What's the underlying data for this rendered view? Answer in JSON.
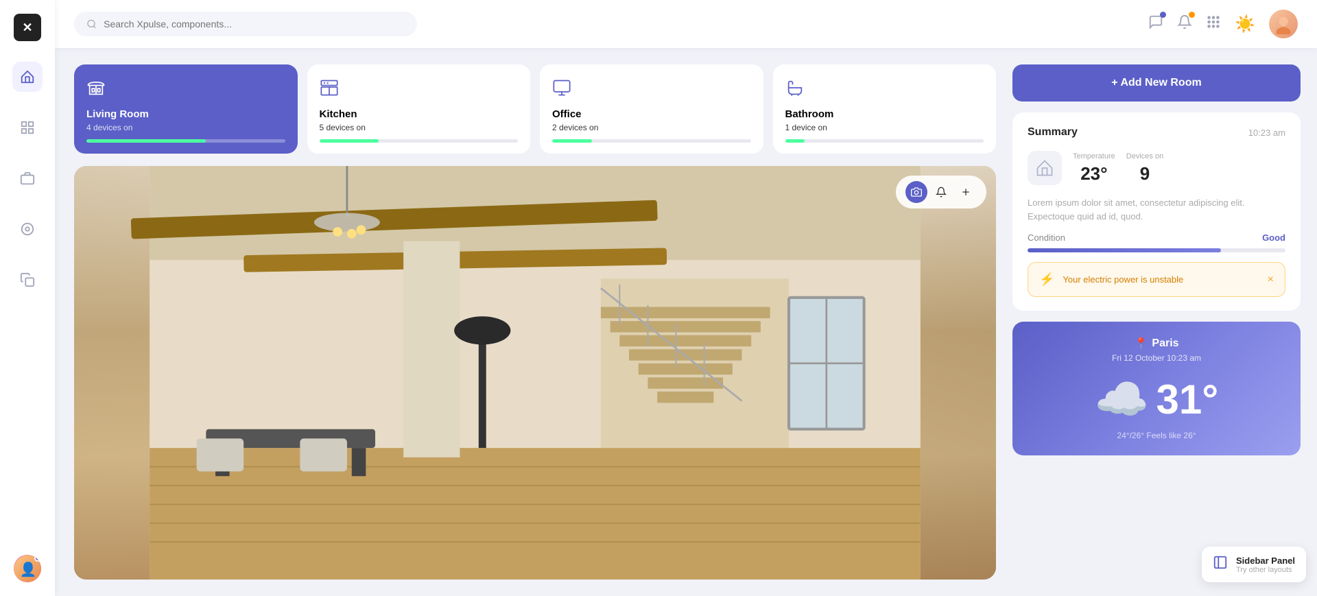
{
  "sidebar": {
    "logo": "✕",
    "icons": [
      {
        "name": "home-icon",
        "symbol": "⊡",
        "active": true
      },
      {
        "name": "grid-icon",
        "symbol": "⊞",
        "active": false
      },
      {
        "name": "briefcase-icon",
        "symbol": "💼",
        "active": false
      },
      {
        "name": "circle-icon",
        "symbol": "◎",
        "active": false
      },
      {
        "name": "copy-icon",
        "symbol": "❐",
        "active": false
      }
    ]
  },
  "header": {
    "search_placeholder": "Search Xpulse, components...",
    "icons": [
      {
        "name": "chat-icon",
        "symbol": "💬",
        "badge": "blue"
      },
      {
        "name": "bell-icon",
        "symbol": "🔔",
        "badge": "orange"
      },
      {
        "name": "grid-icon",
        "symbol": "⠿",
        "badge": null
      }
    ],
    "weather_icon": "☀️"
  },
  "rooms": [
    {
      "name": "Living Room",
      "devices": "4 devices on",
      "icon": "🛋️",
      "active": true,
      "progress": 60
    },
    {
      "name": "Kitchen",
      "devices": "5 devices on",
      "icon": "🍳",
      "active": false,
      "progress": 30
    },
    {
      "name": "Office",
      "devices": "2 devices on",
      "icon": "💻",
      "active": false,
      "progress": 20
    },
    {
      "name": "Bathroom",
      "devices": "1 device on",
      "icon": "🛁",
      "active": false,
      "progress": 10
    }
  ],
  "image_controls": {
    "camera_label": "📷",
    "bell_label": "🔔",
    "plus_label": "+"
  },
  "add_room": {
    "label": "+ Add New Room"
  },
  "summary": {
    "title": "Summary",
    "time": "10:23 am",
    "temperature_label": "Temperature",
    "temperature_value": "23°",
    "devices_label": "Devices on",
    "devices_value": "9",
    "description": "Lorem ipsum dolor sit amet, consectetur adipiscing elit. Expectoque quid ad id, quod.",
    "condition_label": "Condition",
    "condition_value": "Good",
    "condition_percent": 75
  },
  "alert": {
    "text": "Your electric power is unstable",
    "icon": "⚡",
    "close": "×"
  },
  "weather": {
    "location": "Paris",
    "location_icon": "📍",
    "date": "Fri 12 October 10:23 am",
    "temperature": "31°",
    "cloud_icon": "☁️",
    "sub_text": "24°/26° Feels like 26°"
  },
  "sidebar_panel": {
    "title": "Sidebar Panel",
    "subtitle": "Try other layouts",
    "icon": "▦"
  }
}
